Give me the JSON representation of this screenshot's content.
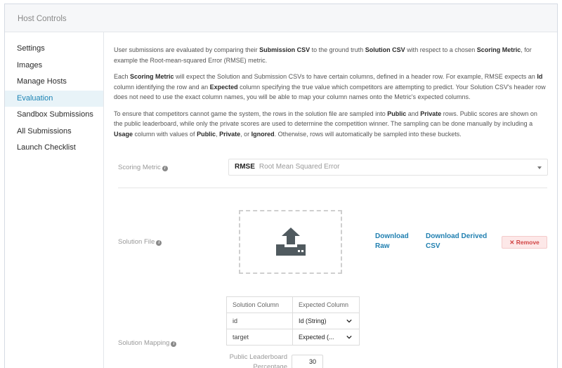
{
  "header": {
    "title": "Host Controls"
  },
  "sidebar": {
    "items": [
      {
        "label": "Settings"
      },
      {
        "label": "Images"
      },
      {
        "label": "Manage Hosts"
      },
      {
        "label": "Evaluation"
      },
      {
        "label": "Sandbox Submissions"
      },
      {
        "label": "All Submissions"
      },
      {
        "label": "Launch Checklist"
      }
    ],
    "active": "Evaluation"
  },
  "intro": {
    "p1": {
      "t1": "User submissions are evaluated by comparing their ",
      "b1": "Submission CSV",
      "t2": " to the ground truth ",
      "b2": "Solution CSV",
      "t3": " with respect to a chosen ",
      "b3": "Scoring Metric",
      "t4": ", for example the Root-mean-squared Error (RMSE) metric."
    },
    "p2": {
      "t1": "Each ",
      "b1": "Scoring Metric",
      "t2": " will expect the Solution and Submission CSVs to have certain columns, defined in a header row. For example, RMSE expects an ",
      "b2": "Id",
      "t3": " column identifying the row and an ",
      "b3": "Expected",
      "t4": " column specifying the true value which competitors are attempting to predict. Your Solution CSV's header row does not need to use the exact column names, you will be able to map your column names onto the Metric's expected columns."
    },
    "p3": {
      "t1": "To ensure that competitors cannot game the system, the rows in the solution file are sampled into ",
      "b1": "Public",
      "t2": " and ",
      "b2": "Private",
      "t3": " rows. Public scores are shown on the public leaderboard, while only the private scores are used to determine the competition winner. The sampling can be done manually by including a ",
      "b3": "Usage",
      "t4": " column with values of ",
      "b4": "Public",
      "t5": ", ",
      "b5": "Private",
      "t6": ", or ",
      "b6": "Ignored",
      "t7": ". Otherwise, rows will automatically be sampled into these buckets."
    }
  },
  "scoring": {
    "label": "Scoring Metric",
    "selected_code": "RMSE",
    "selected_desc": "Root Mean Squared Error"
  },
  "solution_file": {
    "label": "Solution File",
    "upload_icon": "upload-icon",
    "download_raw": "Download Raw",
    "download_derived": "Download Derived CSV",
    "remove": "Remove"
  },
  "mapping": {
    "label": "Solution Mapping",
    "headers": [
      "Solution Column",
      "Expected Column"
    ],
    "rows": [
      {
        "solution": "id",
        "expected": "Id (String)"
      },
      {
        "solution": "target",
        "expected": "Expected (..."
      }
    ]
  },
  "leaderboard": {
    "label": "Public Leaderboard Percentage",
    "value": "30"
  },
  "colors": {
    "accent": "#1c84b4",
    "link": "#1f7fb0",
    "active_bg": "#e8f3f8",
    "remove_bg": "#fde8e8",
    "remove_text": "#d14545"
  }
}
